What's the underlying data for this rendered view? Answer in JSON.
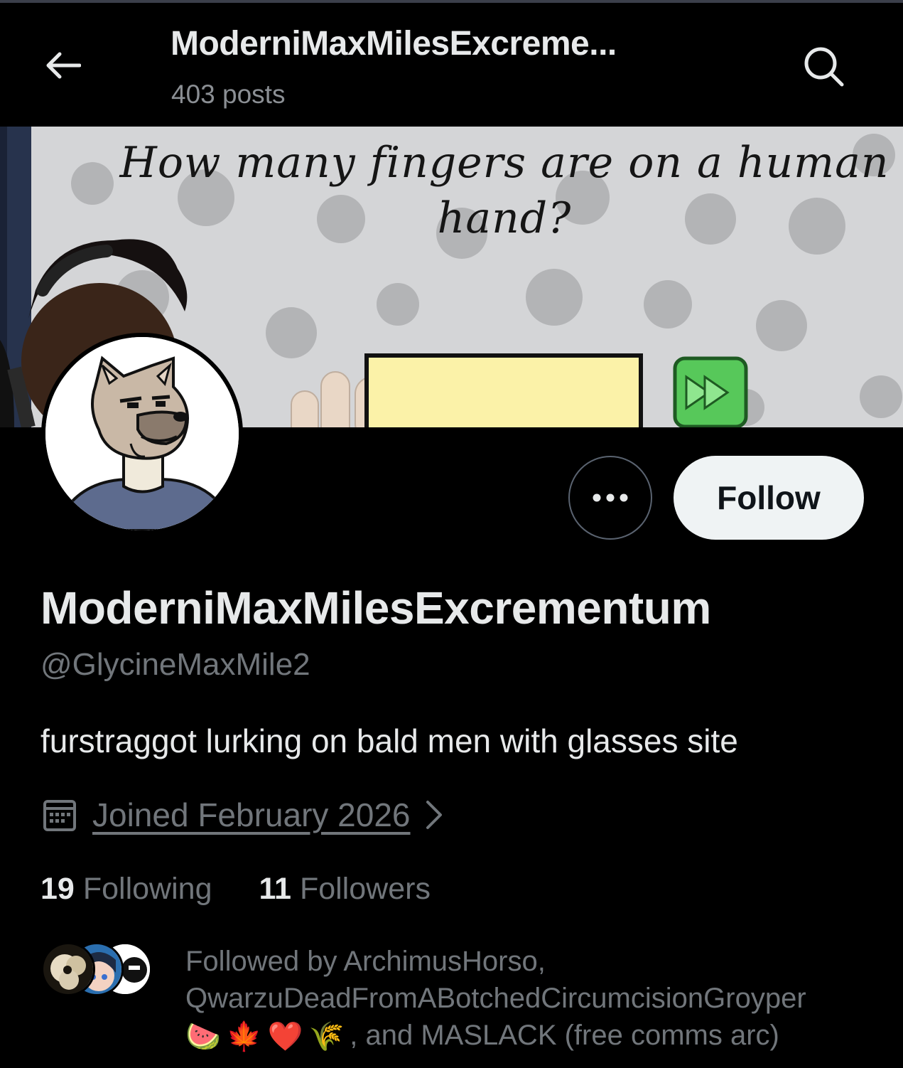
{
  "header": {
    "title": "ModerniMaxMilesExcreme...",
    "posts_count": "403 posts",
    "back_icon": "arrow-left-icon",
    "search_icon": "search-icon"
  },
  "banner": {
    "question": "How many fingers are on a human hand?"
  },
  "profile": {
    "display_name": "ModerniMaxMilesExcrementum",
    "handle": "@GlycineMaxMile2",
    "bio": "furstraggot lurking on bald men with glasses site",
    "joined": "Joined February 2026",
    "joined_chevron": ">"
  },
  "actions": {
    "more_label": "•••",
    "follow_label": "Follow"
  },
  "stats": {
    "following_count": "19",
    "following_label": "Following",
    "followers_count": "11",
    "followers_label": "Followers"
  },
  "followed_by": {
    "line1": "Followed by ArchimusHorso,",
    "line2": "QwarzuDeadFromABotchedCircumcisionGroyper",
    "emojis": [
      "🍉",
      "🍁",
      "❤️",
      "🌾"
    ],
    "line3_suffix": ", and MASLACK (free comms arc)"
  },
  "colors": {
    "background": "#000000",
    "text_primary": "#e7e9ea",
    "text_secondary": "#71767b",
    "follow_bg": "#eff3f4"
  }
}
